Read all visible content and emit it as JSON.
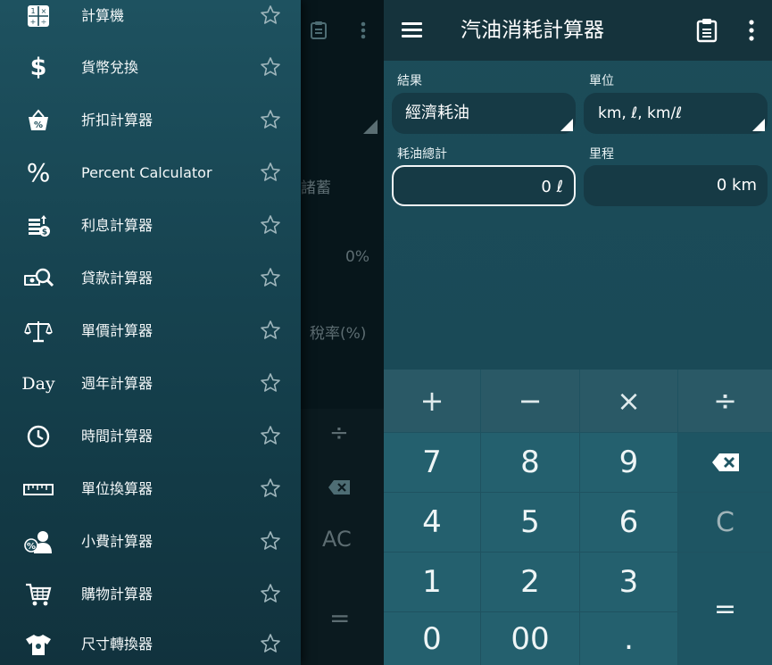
{
  "colors": {
    "drawer_top": "#1e5260",
    "drawer_bottom": "#11323d",
    "accent": "#ffffff",
    "appbar": "#15333c",
    "keypad": "#24606e"
  },
  "background_app": {
    "items": [
      "諸蓄",
      "0%",
      "稅率(%)",
      "AC",
      "="
    ],
    "symbols": {
      "divide": "÷",
      "backspace": "backspace-icon"
    }
  },
  "drawer": {
    "items": [
      {
        "label": "計算機",
        "icon": "calculator-icon"
      },
      {
        "label": "貨幣兌換",
        "icon": "dollar-icon"
      },
      {
        "label": "折扣計算器",
        "icon": "discount-basket-icon"
      },
      {
        "label": "Percent Calculator",
        "icon": "percent-icon"
      },
      {
        "label": "利息計算器",
        "icon": "interest-icon"
      },
      {
        "label": "貸款計算器",
        "icon": "loan-search-icon"
      },
      {
        "label": "單價計算器",
        "icon": "scale-icon"
      },
      {
        "label": "週年計算器",
        "icon": "day-text-icon",
        "icon_text": "Day"
      },
      {
        "label": "時間計算器",
        "icon": "clock-icon"
      },
      {
        "label": "單位換算器",
        "icon": "ruler-icon"
      },
      {
        "label": "小費計算器",
        "icon": "tip-icon"
      },
      {
        "label": "購物計算器",
        "icon": "shopping-cart-icon"
      },
      {
        "label": "尺寸轉換器",
        "icon": "tshirt-icon"
      }
    ]
  },
  "app": {
    "title": "汽油消耗計算器",
    "result_label": "結果",
    "result_value": "經濟耗油",
    "unit_label": "單位",
    "unit_value": "km, ℓ, km/ℓ",
    "consumption_label": "耗油總計",
    "consumption_value": "0 ℓ",
    "distance_label": "里程",
    "distance_value": "0 km"
  },
  "keypad": {
    "operators": [
      "+",
      "−",
      "×",
      "÷"
    ],
    "rows": [
      [
        "7",
        "8",
        "9"
      ],
      [
        "4",
        "5",
        "6"
      ],
      [
        "1",
        "2",
        "3"
      ],
      [
        "0",
        "00",
        "."
      ]
    ],
    "clear": "C",
    "equals": "="
  }
}
